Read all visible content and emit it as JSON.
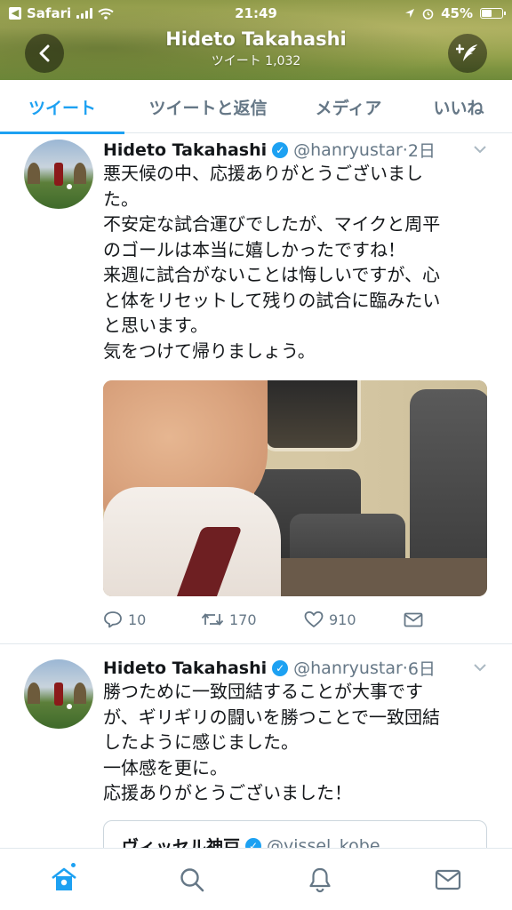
{
  "status_bar": {
    "app": "Safari",
    "time": "21:49",
    "battery": "45%"
  },
  "header": {
    "name": "Hideto Takahashi",
    "tweet_count": "ツイート 1,032"
  },
  "tabs": [
    {
      "label": "ツイート",
      "active": true
    },
    {
      "label": "ツイートと返信",
      "active": false
    },
    {
      "label": "メディア",
      "active": false
    },
    {
      "label": "いいね",
      "active": false
    }
  ],
  "tweets": [
    {
      "name": "Hideto Takahashi",
      "handle": "@hanryustar",
      "time": "2日",
      "lines": [
        "悪天候の中、応援ありがとうございまし",
        "た。",
        "不安定な試合運びでしたが、マイクと周平",
        "のゴールは本当に嬉しかったですね！",
        "来週に試合がないことは悔しいですが、心",
        "と体をリセットして残りの試合に臨みたい",
        "と思います。",
        "気をつけて帰りましょう。"
      ],
      "replies": "10",
      "retweets": "170",
      "likes": "910"
    },
    {
      "name": "Hideto Takahashi",
      "handle": "@hanryustar",
      "time": "6日",
      "lines": [
        "勝つために一致団結することが大事です",
        "が、ギリギリの闘いを勝つことで一致団結",
        "したように感じました。",
        "一体感を更に。",
        "応援ありがとうございました！"
      ],
      "quote": {
        "name": "ヴィッセル神戸",
        "handle": "@vissel_kobe"
      }
    }
  ],
  "colors": {
    "accent": "#1da1f2",
    "muted": "#657786"
  }
}
